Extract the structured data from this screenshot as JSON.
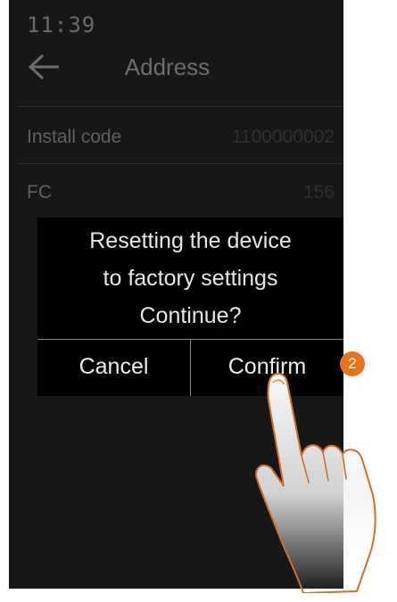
{
  "status_bar": {
    "time": "11:39"
  },
  "header": {
    "title": "Address",
    "back_icon": "arrow-left-icon"
  },
  "rows": [
    {
      "label": "Install code",
      "value": "1100000002"
    },
    {
      "label": "FC",
      "value": "156"
    }
  ],
  "dialog": {
    "lines": [
      "Resetting the device",
      "to factory settings",
      "Continue?"
    ],
    "cancel_label": "Cancel",
    "confirm_label": "Confirm"
  },
  "callout": {
    "step": "2",
    "color": "#e8731f"
  }
}
